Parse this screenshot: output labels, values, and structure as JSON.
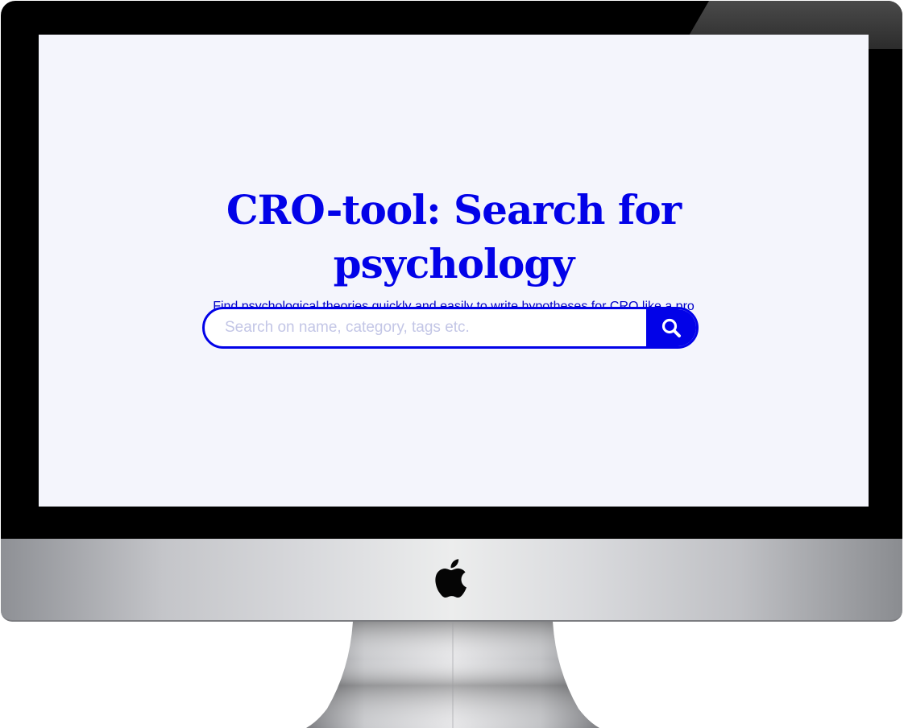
{
  "hero": {
    "title": "CRO-tool: Search for psychology",
    "subtitle": "Find psychological theories quickly and easily to write hypotheses for CRO like a pro"
  },
  "search": {
    "placeholder": "Search on name, category, tags etc.",
    "value": ""
  },
  "icons": {
    "search_button": "search-icon",
    "device_logo": "apple-logo"
  },
  "colors": {
    "accent": "#0202e8",
    "screen_background": "#f4f5fc",
    "placeholder": "#c3c6e6"
  }
}
